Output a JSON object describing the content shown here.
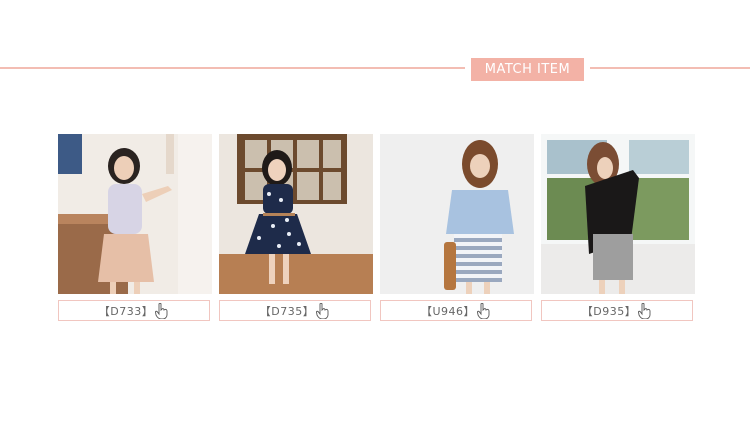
{
  "header": {
    "badge": "MATCH ITEM",
    "accent_color": "#f3b2a6",
    "rule_color": "#f3bdb3"
  },
  "items": [
    {
      "code": "【D733】",
      "icon": "pointer-hand-icon"
    },
    {
      "code": "【D735】",
      "icon": "pointer-hand-icon"
    },
    {
      "code": "【U946】",
      "icon": "pointer-hand-icon"
    },
    {
      "code": "【D935】",
      "icon": "pointer-hand-icon"
    }
  ]
}
